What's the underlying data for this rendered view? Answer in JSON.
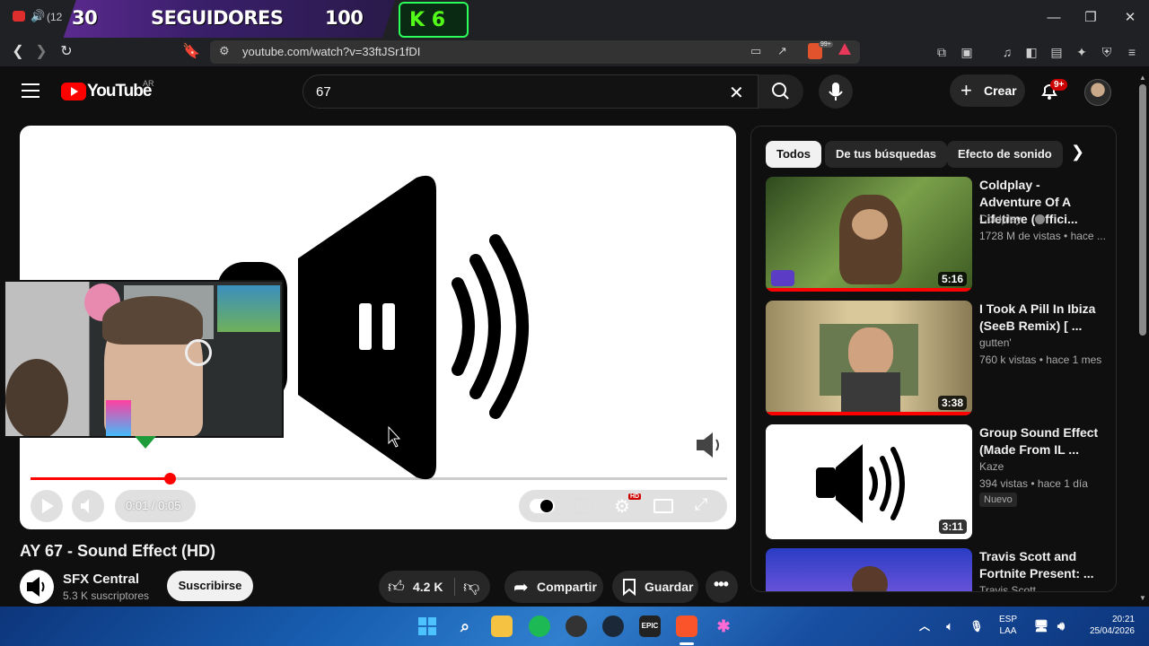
{
  "browser": {
    "tab_text": "(12",
    "overlay": {
      "followers_current": "30",
      "followers_label": "SEGUIDORES",
      "followers_goal": "100",
      "kick_label": "K 6"
    },
    "url": "youtube.com/watch?v=33ftJSr1fDI",
    "badge_count": "99+"
  },
  "youtube": {
    "logo_text": "YouTube",
    "region": "AR",
    "search": {
      "value": "67"
    },
    "create_label": "Crear",
    "notifications_badge": "9+"
  },
  "player": {
    "time_display": "0:01 / 0:05",
    "progress": 0.2,
    "hd_badge": "HD"
  },
  "video": {
    "title": "AY 67 - Sound Effect (HD)",
    "channel": {
      "name": "SFX Central",
      "subscribers": "5.3 K suscriptores"
    },
    "subscribe_label": "Suscribirse",
    "like_count": "4.2 K",
    "share_label": "Compartir",
    "save_label": "Guardar"
  },
  "sidebar": {
    "chips": [
      "Todos",
      "De tus búsquedas",
      "Efecto de sonido"
    ],
    "recommendations": [
      {
        "title": "Coldplay - Adventure Of A Lifetime (Offici...",
        "channel": "Coldplay",
        "meta": "1728 M de vistas • hace ...",
        "duration": "5:16",
        "badge": ""
      },
      {
        "title": "I Took A Pill In Ibiza (SeeB Remix) [ ...",
        "channel": "gutten'",
        "meta": "760 k vistas • hace 1 mes",
        "duration": "3:38",
        "badge": ""
      },
      {
        "title": "Group Sound Effect (Made From IL ...",
        "channel": "Kaze",
        "meta": "394 vistas • hace 1 día",
        "duration": "3:11",
        "badge": "Nuevo"
      },
      {
        "title": "Travis Scott and Fortnite Present: ...",
        "channel": "Travis Scott",
        "meta": "",
        "duration": "",
        "badge": ""
      }
    ]
  },
  "taskbar": {
    "lang_line1": "ESP",
    "lang_line2": "LAA",
    "time": "20:21",
    "date": "25/04/2026",
    "epic_label": "EPIC"
  },
  "colors": {
    "yt_red": "#ff0000",
    "background": "#0f0f0f",
    "kick_green": "#53fc18"
  }
}
